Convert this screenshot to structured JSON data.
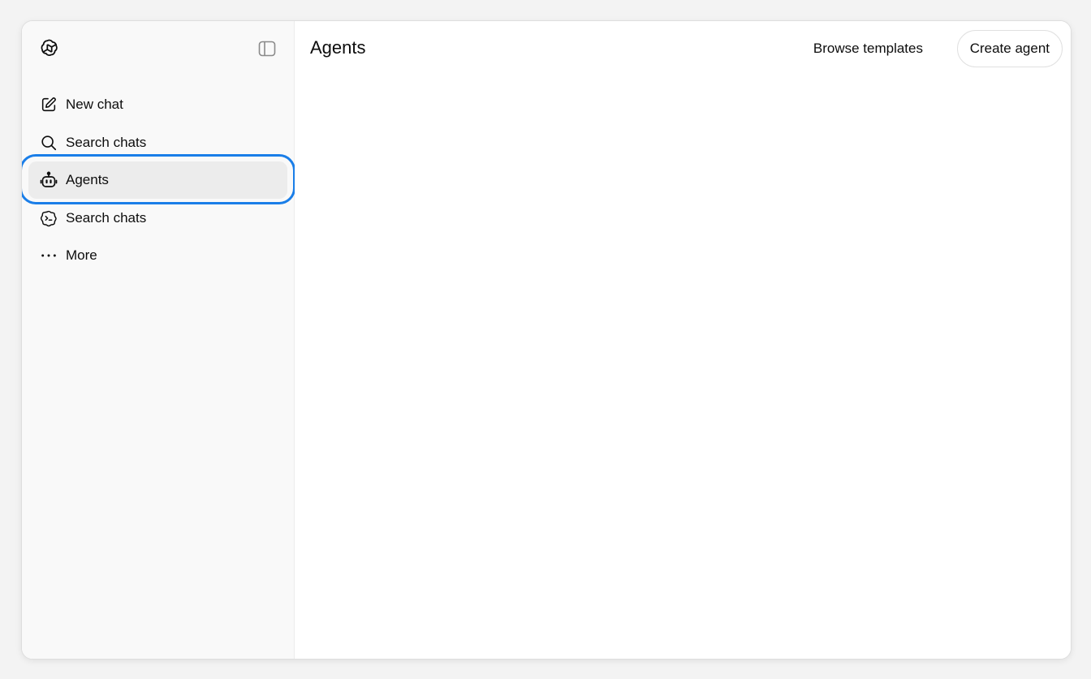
{
  "sidebar": {
    "logo_icon": "openai-logo-icon",
    "toggle_icon": "sidebar-toggle-icon",
    "items": [
      {
        "label": "New chat",
        "icon": "edit-icon",
        "active": false
      },
      {
        "label": "Search chats",
        "icon": "search-icon",
        "active": false
      },
      {
        "label": "Agents",
        "icon": "robot-icon",
        "active": true
      },
      {
        "label": "Search chats",
        "icon": "chat-bubble-icon",
        "active": false
      },
      {
        "label": "More",
        "icon": "more-icon",
        "active": false
      }
    ]
  },
  "main": {
    "title": "Agents",
    "browse_label": "Browse templates",
    "create_label": "Create agent"
  },
  "colors": {
    "highlight": "#1a7ee8",
    "active_bg": "#ececec",
    "sidebar_bg": "#f9f9f9"
  }
}
